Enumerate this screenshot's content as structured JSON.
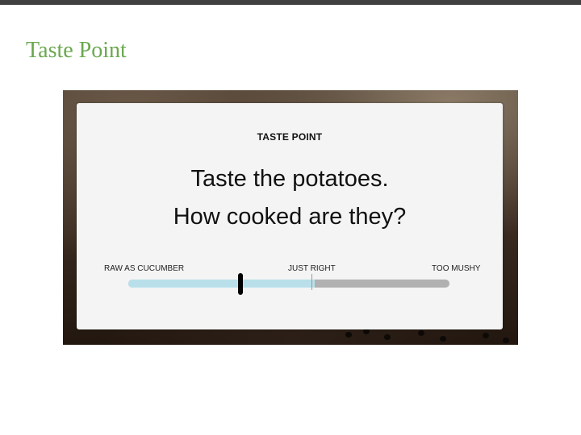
{
  "slide": {
    "title": "Taste Point"
  },
  "card": {
    "header": "TASTE POINT",
    "question_line1": "Taste the potatoes.",
    "question_line2": "How cooked are they?"
  },
  "slider": {
    "left_label": "RAW AS CUCUMBER",
    "middle_label": "JUST RIGHT",
    "right_label": "TOO MUSHY",
    "value_fraction": 0.35,
    "fill_fraction": 0.58
  },
  "colors": {
    "title": "#6aa84f",
    "track_fill": "#b9e0ea",
    "track": "#b1b1b1",
    "thumb": "#000000"
  }
}
